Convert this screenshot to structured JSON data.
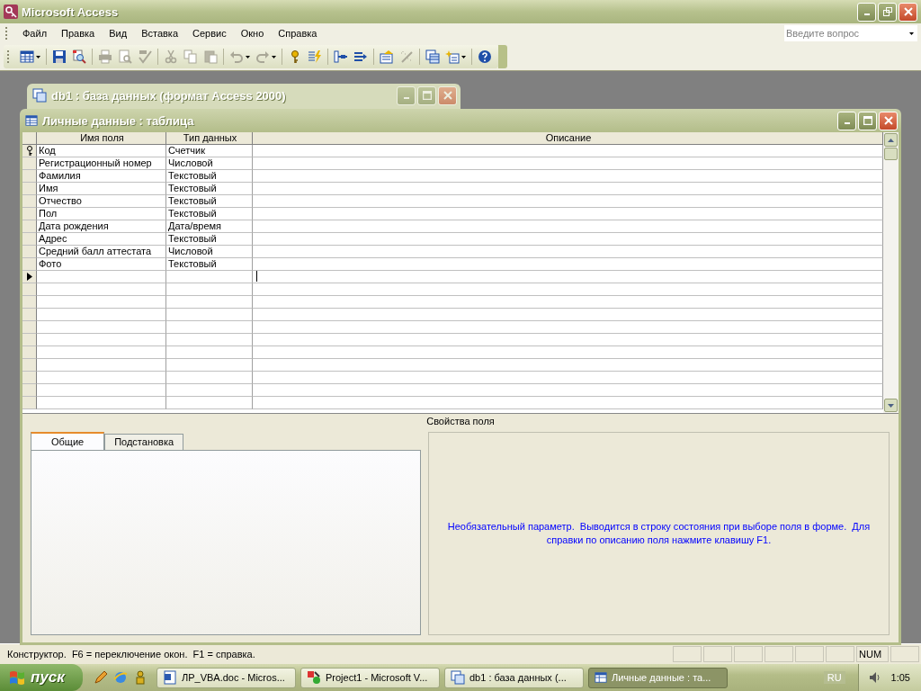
{
  "window": {
    "title": "Microsoft Access"
  },
  "menu": [
    "Файл",
    "Правка",
    "Вид",
    "Вставка",
    "Сервис",
    "Окно",
    "Справка"
  ],
  "question_box": {
    "placeholder": "Введите вопрос"
  },
  "toolbar": [
    [
      {
        "kind": "table",
        "disabled": false,
        "dropdown": true
      }
    ],
    [
      {
        "kind": "save",
        "disabled": false,
        "dropdown": false
      },
      {
        "kind": "search",
        "disabled": false,
        "dropdown": false
      }
    ],
    [
      {
        "kind": "printer",
        "disabled": true,
        "dropdown": false
      },
      {
        "kind": "preview",
        "disabled": true,
        "dropdown": false
      },
      {
        "kind": "spelling",
        "disabled": true,
        "dropdown": false
      }
    ],
    [
      {
        "kind": "cut",
        "disabled": true,
        "dropdown": false
      },
      {
        "kind": "copy",
        "disabled": true,
        "dropdown": false
      },
      {
        "kind": "paste",
        "disabled": true,
        "dropdown": false
      }
    ],
    [
      {
        "kind": "undo",
        "disabled": true,
        "dropdown": true
      },
      {
        "kind": "redo",
        "disabled": true,
        "dropdown": true
      }
    ],
    [
      {
        "kind": "key",
        "disabled": false,
        "dropdown": false
      },
      {
        "kind": "lightning",
        "disabled": false,
        "dropdown": false
      }
    ],
    [
      {
        "kind": "insert-rows",
        "disabled": false,
        "dropdown": false
      },
      {
        "kind": "delete-rows",
        "disabled": false,
        "dropdown": false
      }
    ],
    [
      {
        "kind": "properties",
        "disabled": false,
        "dropdown": false
      },
      {
        "kind": "wand",
        "disabled": true,
        "dropdown": false
      }
    ],
    [
      {
        "kind": "database-window",
        "disabled": false,
        "dropdown": false
      },
      {
        "kind": "new-object",
        "disabled": false,
        "dropdown": true
      }
    ],
    [
      {
        "kind": "help",
        "disabled": false,
        "dropdown": false
      }
    ]
  ],
  "database_window": {
    "title": "db1 : база данных (формат Access 2000)"
  },
  "table_window": {
    "title": "Личные данные : таблица",
    "columns": [
      "Имя поля",
      "Тип данных",
      "Описание"
    ],
    "rows": [
      {
        "name": "Код",
        "type": "Счетчик",
        "primary_key": true,
        "current": false
      },
      {
        "name": "Регистрационный номер",
        "type": "Числовой",
        "primary_key": false,
        "current": false
      },
      {
        "name": "Фамилия",
        "type": "Текстовый",
        "primary_key": false,
        "current": false
      },
      {
        "name": "Имя",
        "type": "Текстовый",
        "primary_key": false,
        "current": false
      },
      {
        "name": "Отчество",
        "type": "Текстовый",
        "primary_key": false,
        "current": false
      },
      {
        "name": "Пол",
        "type": "Текстовый",
        "primary_key": false,
        "current": false
      },
      {
        "name": "Дата рождения",
        "type": "Дата/время",
        "primary_key": false,
        "current": false
      },
      {
        "name": "Адрес",
        "type": "Текстовый",
        "primary_key": false,
        "current": false
      },
      {
        "name": "Средний балл аттестата",
        "type": "Числовой",
        "primary_key": false,
        "current": false
      },
      {
        "name": "Фото",
        "type": "Текстовый",
        "primary_key": false,
        "current": false
      },
      {
        "name": "",
        "type": "",
        "primary_key": false,
        "current": true
      }
    ],
    "properties_label": "Свойства поля",
    "tabs": [
      {
        "label": "Общие",
        "selected": true
      },
      {
        "label": "Подстановка",
        "selected": false
      }
    ],
    "help_text": "Необязательный параметр.  Выводится в строку состояния при выборе поля в форме.  Для справки по описанию поля нажмите клавишу F1."
  },
  "status_bar": {
    "text": "Конструктор.  F6 = переключение окон.  F1 = справка.",
    "indicators": [
      "NUM"
    ]
  },
  "taskbar": {
    "start": "пуск",
    "tasks": [
      {
        "label": "ЛР_VBA.doc - Micros...",
        "selected": false,
        "kind": "word"
      },
      {
        "label": "Project1 - Microsoft V...",
        "selected": false,
        "kind": "vb"
      },
      {
        "label": "db1 : база данных (...",
        "selected": false,
        "kind": "db"
      },
      {
        "label": "Личные данные : та...",
        "selected": true,
        "kind": "table"
      }
    ],
    "language": "RU",
    "clock": "1:05"
  }
}
